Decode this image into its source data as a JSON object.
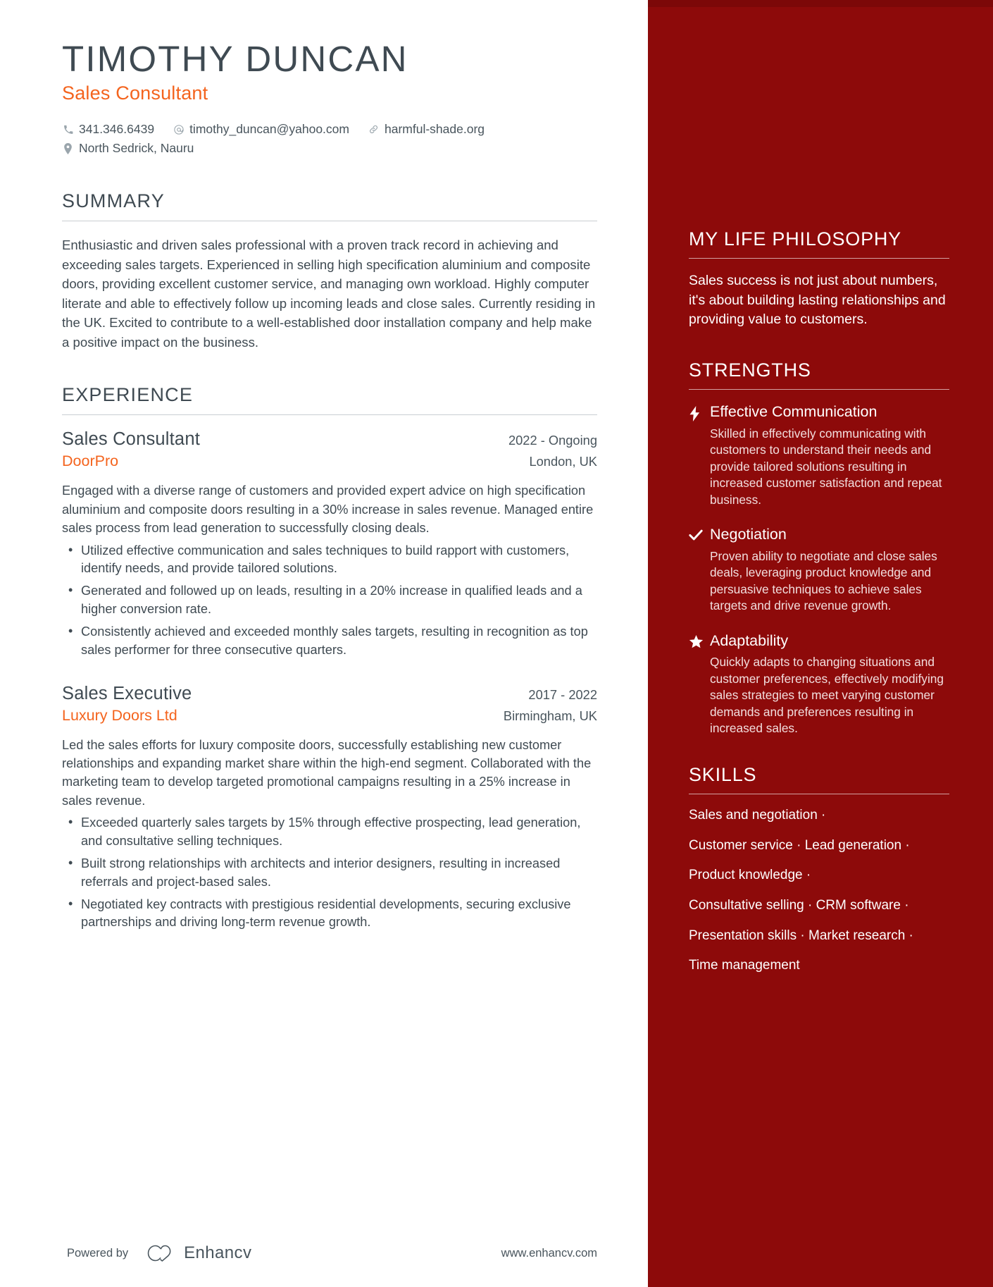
{
  "header": {
    "name": "TIMOTHY DUNCAN",
    "job_title": "Sales Consultant",
    "contacts": [
      {
        "icon": "phone-icon",
        "value": "341.346.6439"
      },
      {
        "icon": "email-icon",
        "value": "timothy_duncan@yahoo.com"
      },
      {
        "icon": "link-icon",
        "value": "harmful-shade.org"
      }
    ],
    "location": {
      "icon": "location-pin-icon",
      "value": "North Sedrick, Nauru"
    }
  },
  "summary": {
    "heading": "SUMMARY",
    "text": "Enthusiastic and driven sales professional with a proven track record in achieving and exceeding sales targets. Experienced in selling high specification aluminium and composite doors, providing excellent customer service, and managing own workload. Highly computer literate and able to effectively follow up incoming leads and close sales. Currently residing in the UK. Excited to contribute to a well-established door installation company and help make a positive impact on the business."
  },
  "experience": {
    "heading": "EXPERIENCE",
    "jobs": [
      {
        "position": "Sales Consultant",
        "dates": "2022 - Ongoing",
        "company": "DoorPro",
        "location": "London, UK",
        "description": "Engaged with a diverse range of customers and provided expert advice on high specification aluminium and composite doors resulting in a 30% increase in sales revenue. Managed entire sales process from lead generation to successfully closing deals.",
        "bullets": [
          "Utilized effective communication and sales techniques to build rapport with customers, identify needs, and provide tailored solutions.",
          "Generated and followed up on leads, resulting in a 20% increase in qualified leads and a higher conversion rate.",
          "Consistently achieved and exceeded monthly sales targets, resulting in recognition as top sales performer for three consecutive quarters."
        ]
      },
      {
        "position": "Sales Executive",
        "dates": "2017 - 2022",
        "company": "Luxury Doors Ltd",
        "location": "Birmingham, UK",
        "description": "Led the sales efforts for luxury composite doors, successfully establishing new customer relationships and expanding market share within the high-end segment. Collaborated with the marketing team to develop targeted promotional campaigns resulting in a 25% increase in sales revenue.",
        "bullets": [
          "Exceeded quarterly sales targets by 15% through effective prospecting, lead generation, and consultative selling techniques.",
          "Built strong relationships with architects and interior designers, resulting in increased referrals and project-based sales.",
          "Negotiated key contracts with prestigious residential developments, securing exclusive partnerships and driving long-term revenue growth."
        ]
      }
    ]
  },
  "philosophy": {
    "heading": "MY LIFE PHILOSOPHY",
    "text": "Sales success is not just about numbers, it's about building lasting relationships and providing value to customers."
  },
  "strengths": {
    "heading": "STRENGTHS",
    "items": [
      {
        "icon": "lightning-bolt-icon",
        "title": "Effective Communication",
        "description": "Skilled in effectively communicating with customers to understand their needs and provide tailored solutions resulting in increased customer satisfaction and repeat business."
      },
      {
        "icon": "checkmark-icon",
        "title": "Negotiation",
        "description": "Proven ability to negotiate and close sales deals, leveraging product knowledge and persuasive techniques to achieve sales targets and drive revenue growth."
      },
      {
        "icon": "star-icon",
        "title": "Adaptability",
        "description": "Quickly adapts to changing situations and customer preferences, effectively modifying sales strategies to meet varying customer demands and preferences resulting in increased sales."
      }
    ]
  },
  "skills": {
    "heading": "SKILLS",
    "lines": [
      "Sales and negotiation ·",
      "Customer service · Lead generation ·",
      "Product knowledge ·",
      "Consultative selling · CRM software ·",
      "Presentation skills · Market research ·",
      "Time management"
    ]
  },
  "footer": {
    "powered_by": "Powered by",
    "brand": "Enhancv",
    "url": "www.enhancv.com"
  },
  "colors": {
    "accent_orange": "#f4641e",
    "sidebar_red": "#8d0a0a",
    "text_dark": "#3f4a52"
  }
}
